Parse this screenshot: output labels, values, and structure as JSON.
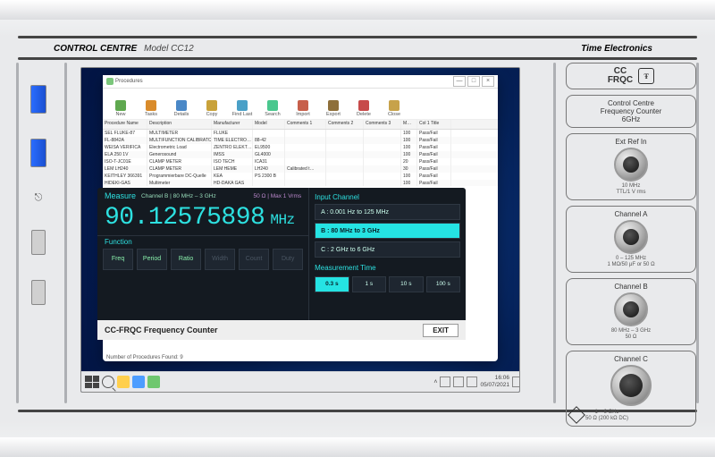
{
  "bezel": {
    "cc_label": "CONTROL CENTRE",
    "model": "Model CC12",
    "brand": "Time Electronics"
  },
  "window": {
    "title": "Procedures",
    "status": "Number of Procedures Found: 9"
  },
  "window_controls": {
    "min": "—",
    "max": "□",
    "close": "×"
  },
  "toolbar": [
    {
      "label": "New",
      "cls": "c-new"
    },
    {
      "label": "Tasks",
      "cls": "c-tasks"
    },
    {
      "label": "Details",
      "cls": "c-details"
    },
    {
      "label": "Copy",
      "cls": "c-copy"
    },
    {
      "label": "Find Last",
      "cls": "c-findlast"
    },
    {
      "label": "Search",
      "cls": "c-search"
    },
    {
      "label": "Import",
      "cls": "c-import"
    },
    {
      "label": "Export",
      "cls": "c-export"
    },
    {
      "label": "Delete",
      "cls": "c-delete"
    },
    {
      "label": "Close",
      "cls": "c-close"
    }
  ],
  "table": {
    "headers": [
      "Procedure Name",
      "Description",
      "Manufacturer",
      "Model",
      "Comments 1",
      "Comments 2",
      "Comments 3",
      "M…",
      "Col 1 Title"
    ],
    "rows": [
      [
        "SEL FLUKE-87",
        "MULTIMETER",
        "FLUKE",
        "",
        "",
        "",
        "",
        "100",
        "Pass/Fail"
      ],
      [
        "FL-8842A",
        "MULTIFUNCTION CALIBRATOR",
        "TIME ELECTRO…",
        "88-42",
        "",
        "",
        "",
        "100",
        "Pass/Fail"
      ],
      [
        "WEISA VERIFICA",
        "Electrometric Load",
        "ZENTRO ELEKT…",
        "EL9500",
        "",
        "",
        "",
        "100",
        "Pass/Fail"
      ],
      [
        "ELA 250 1V",
        "Generosound",
        "IMSS",
        "GL4000",
        "",
        "",
        "",
        "100",
        "Pass/Fail"
      ],
      [
        "ISO-T-JC01E",
        "CLAMP METER",
        "ISO TECH",
        "ICA31",
        "",
        "",
        "",
        "20",
        "Pass/Fail"
      ],
      [
        "LEM LH240",
        "CLAMP METER",
        "LEM HEME",
        "LH240",
        "Calibrated t…",
        "",
        "",
        "30",
        "Pass/Fail"
      ],
      [
        "KEITHLEY 366391",
        "Programmierbare DC-Quelle",
        "KEA",
        "PS 2300 B",
        "",
        "",
        "",
        "100",
        "Pass/Fail"
      ],
      [
        "HIDEKI-GAS",
        "Multimeter",
        "HD-DAKA GAS",
        "",
        "",
        "",
        "",
        "100",
        "Pass/Fail"
      ]
    ]
  },
  "measure": {
    "title": "Measure",
    "channel_sub": "Channel B | 80 MHz – 3 GHz",
    "imp": "50 Ω  |  Max 1 Vrms",
    "reading": "90.12575898",
    "unit": "MHz",
    "fn_title": "Function",
    "fns": [
      {
        "l": "Freq",
        "d": 0
      },
      {
        "l": "Period",
        "d": 0
      },
      {
        "l": "Ratio",
        "d": 0
      },
      {
        "l": "Width",
        "d": 1
      },
      {
        "l": "Count",
        "d": 1
      },
      {
        "l": "Duty",
        "d": 1
      }
    ],
    "input_title": "Input Channel",
    "inputs": [
      {
        "l": "A : 0.001 Hz to 125 MHz",
        "sel": 0
      },
      {
        "l": "B : 80 MHz to 3 GHz",
        "sel": 1
      },
      {
        "l": "C : 2 GHz to 6 GHz",
        "sel": 0
      }
    ],
    "mt_title": "Measurement Time",
    "mts": [
      {
        "l": "0.3 s",
        "sel": 1
      },
      {
        "l": "1 s",
        "sel": 0
      },
      {
        "l": "10 s",
        "sel": 0
      },
      {
        "l": "100 s",
        "sel": 0
      }
    ],
    "footer_title": "CC-FRQC Frequency Counter",
    "exit": "EXIT"
  },
  "taskbar": {
    "time": "16:06",
    "date": "05/07/2021"
  },
  "rpanel": {
    "title_l1": "CC",
    "title_l2": "FRQC",
    "subtitle": "Control Centre\nFrequency Counter\n6GHz",
    "ext": {
      "h": "Ext Ref In",
      "sub": "10 MHz\nTTL/1 V rms"
    },
    "chA": {
      "h": "Channel A",
      "sub": "0 – 125 MHz\n1 MΩ/50 μF or 50 Ω"
    },
    "chB": {
      "h": "Channel B",
      "sub": "80 MHz – 3 GHz\n50 Ω"
    },
    "chC": {
      "h": "Channel C",
      "sub": "1 – 6 GHz\n50 Ω (200 kΩ DC)"
    }
  }
}
